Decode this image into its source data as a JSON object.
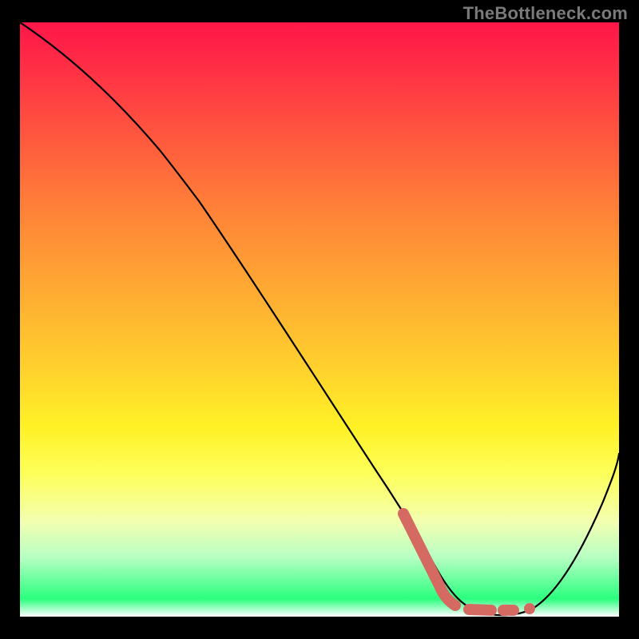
{
  "attribution": "TheBottleneck.com",
  "chart_data": {
    "type": "line",
    "title": "",
    "xlabel": "",
    "ylabel": "",
    "xlim": [
      0,
      100
    ],
    "ylim": [
      0,
      100
    ],
    "grid": false,
    "legend": false,
    "series": [
      {
        "name": "curve-black",
        "x": [
          0,
          5,
          10,
          15,
          20,
          24,
          28,
          35,
          45,
          55,
          62,
          66,
          70,
          74,
          78,
          82,
          86,
          90,
          95,
          100
        ],
        "y": [
          100,
          95,
          90,
          86,
          80,
          76,
          72,
          60,
          44,
          28,
          16,
          10,
          6,
          3,
          1,
          0,
          2,
          8,
          18,
          30
        ]
      }
    ],
    "highlight": {
      "name": "marker-red",
      "description": "thick salmon highlight on the descending limb near the trough, then short dashes and a dot across the flat bottom",
      "segments": [
        {
          "type": "line",
          "x": [
            63,
            70
          ],
          "y": [
            15,
            3
          ]
        },
        {
          "type": "dash",
          "x": [
            70,
            76
          ],
          "y": [
            3,
            1
          ]
        },
        {
          "type": "dash",
          "x": [
            78,
            80
          ],
          "y": [
            1,
            1
          ]
        },
        {
          "type": "dot",
          "x": 83.5,
          "y": 1
        }
      ]
    },
    "background_gradient": {
      "direction": "top-to-bottom",
      "stops": [
        {
          "pos": 0.0,
          "color": "#ff1649"
        },
        {
          "pos": 0.5,
          "color": "#ffd02d"
        },
        {
          "pos": 0.8,
          "color": "#fdff5a"
        },
        {
          "pos": 0.95,
          "color": "#2aff7e"
        },
        {
          "pos": 1.0,
          "color": "#ffffff"
        }
      ]
    }
  }
}
